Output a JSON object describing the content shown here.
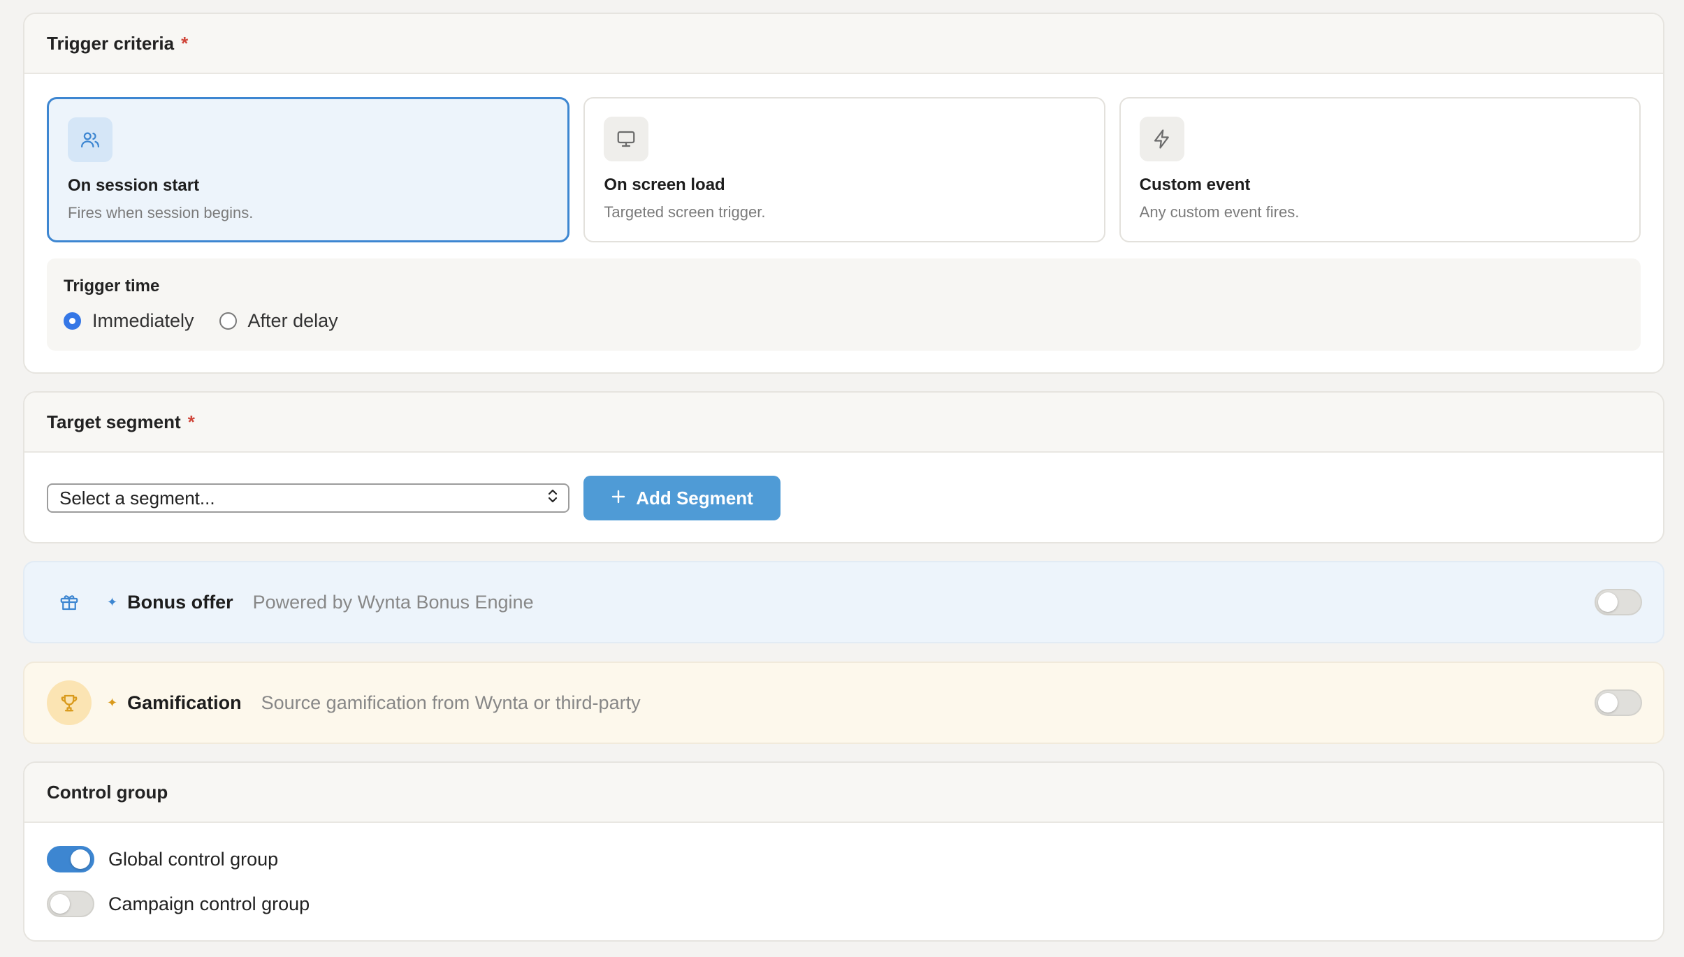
{
  "trigger": {
    "title": "Trigger criteria",
    "required_mark": "*",
    "options": [
      {
        "title": "On session start",
        "desc": "Fires when session begins.",
        "icon": "users-icon",
        "selected": true
      },
      {
        "title": "On screen load",
        "desc": "Targeted screen trigger.",
        "icon": "monitor-icon",
        "selected": false
      },
      {
        "title": "Custom event",
        "desc": "Any custom event fires.",
        "icon": "zap-icon",
        "selected": false
      }
    ],
    "time": {
      "label": "Trigger time",
      "options": [
        {
          "label": "Immediately",
          "checked": true
        },
        {
          "label": "After delay",
          "checked": false
        }
      ]
    }
  },
  "segment": {
    "title": "Target segment",
    "required_mark": "*",
    "select_value": "Select a segment...",
    "add_label": "Add Segment"
  },
  "bonus": {
    "title": "Bonus offer",
    "subtitle": "Powered by Wynta Bonus Engine",
    "icon": "gift-icon",
    "enabled": false
  },
  "gamification": {
    "title": "Gamification",
    "subtitle": "Source gamification from Wynta or third-party",
    "icon": "trophy-icon",
    "enabled": false
  },
  "control": {
    "title": "Control group",
    "items": [
      {
        "label": "Global control group",
        "enabled": true
      },
      {
        "label": "Campaign control group",
        "enabled": false
      }
    ]
  },
  "colors": {
    "accent": "#3d86d1",
    "button": "#4f9bd6",
    "required": "#d0463a",
    "gold": "#d99a1c"
  }
}
